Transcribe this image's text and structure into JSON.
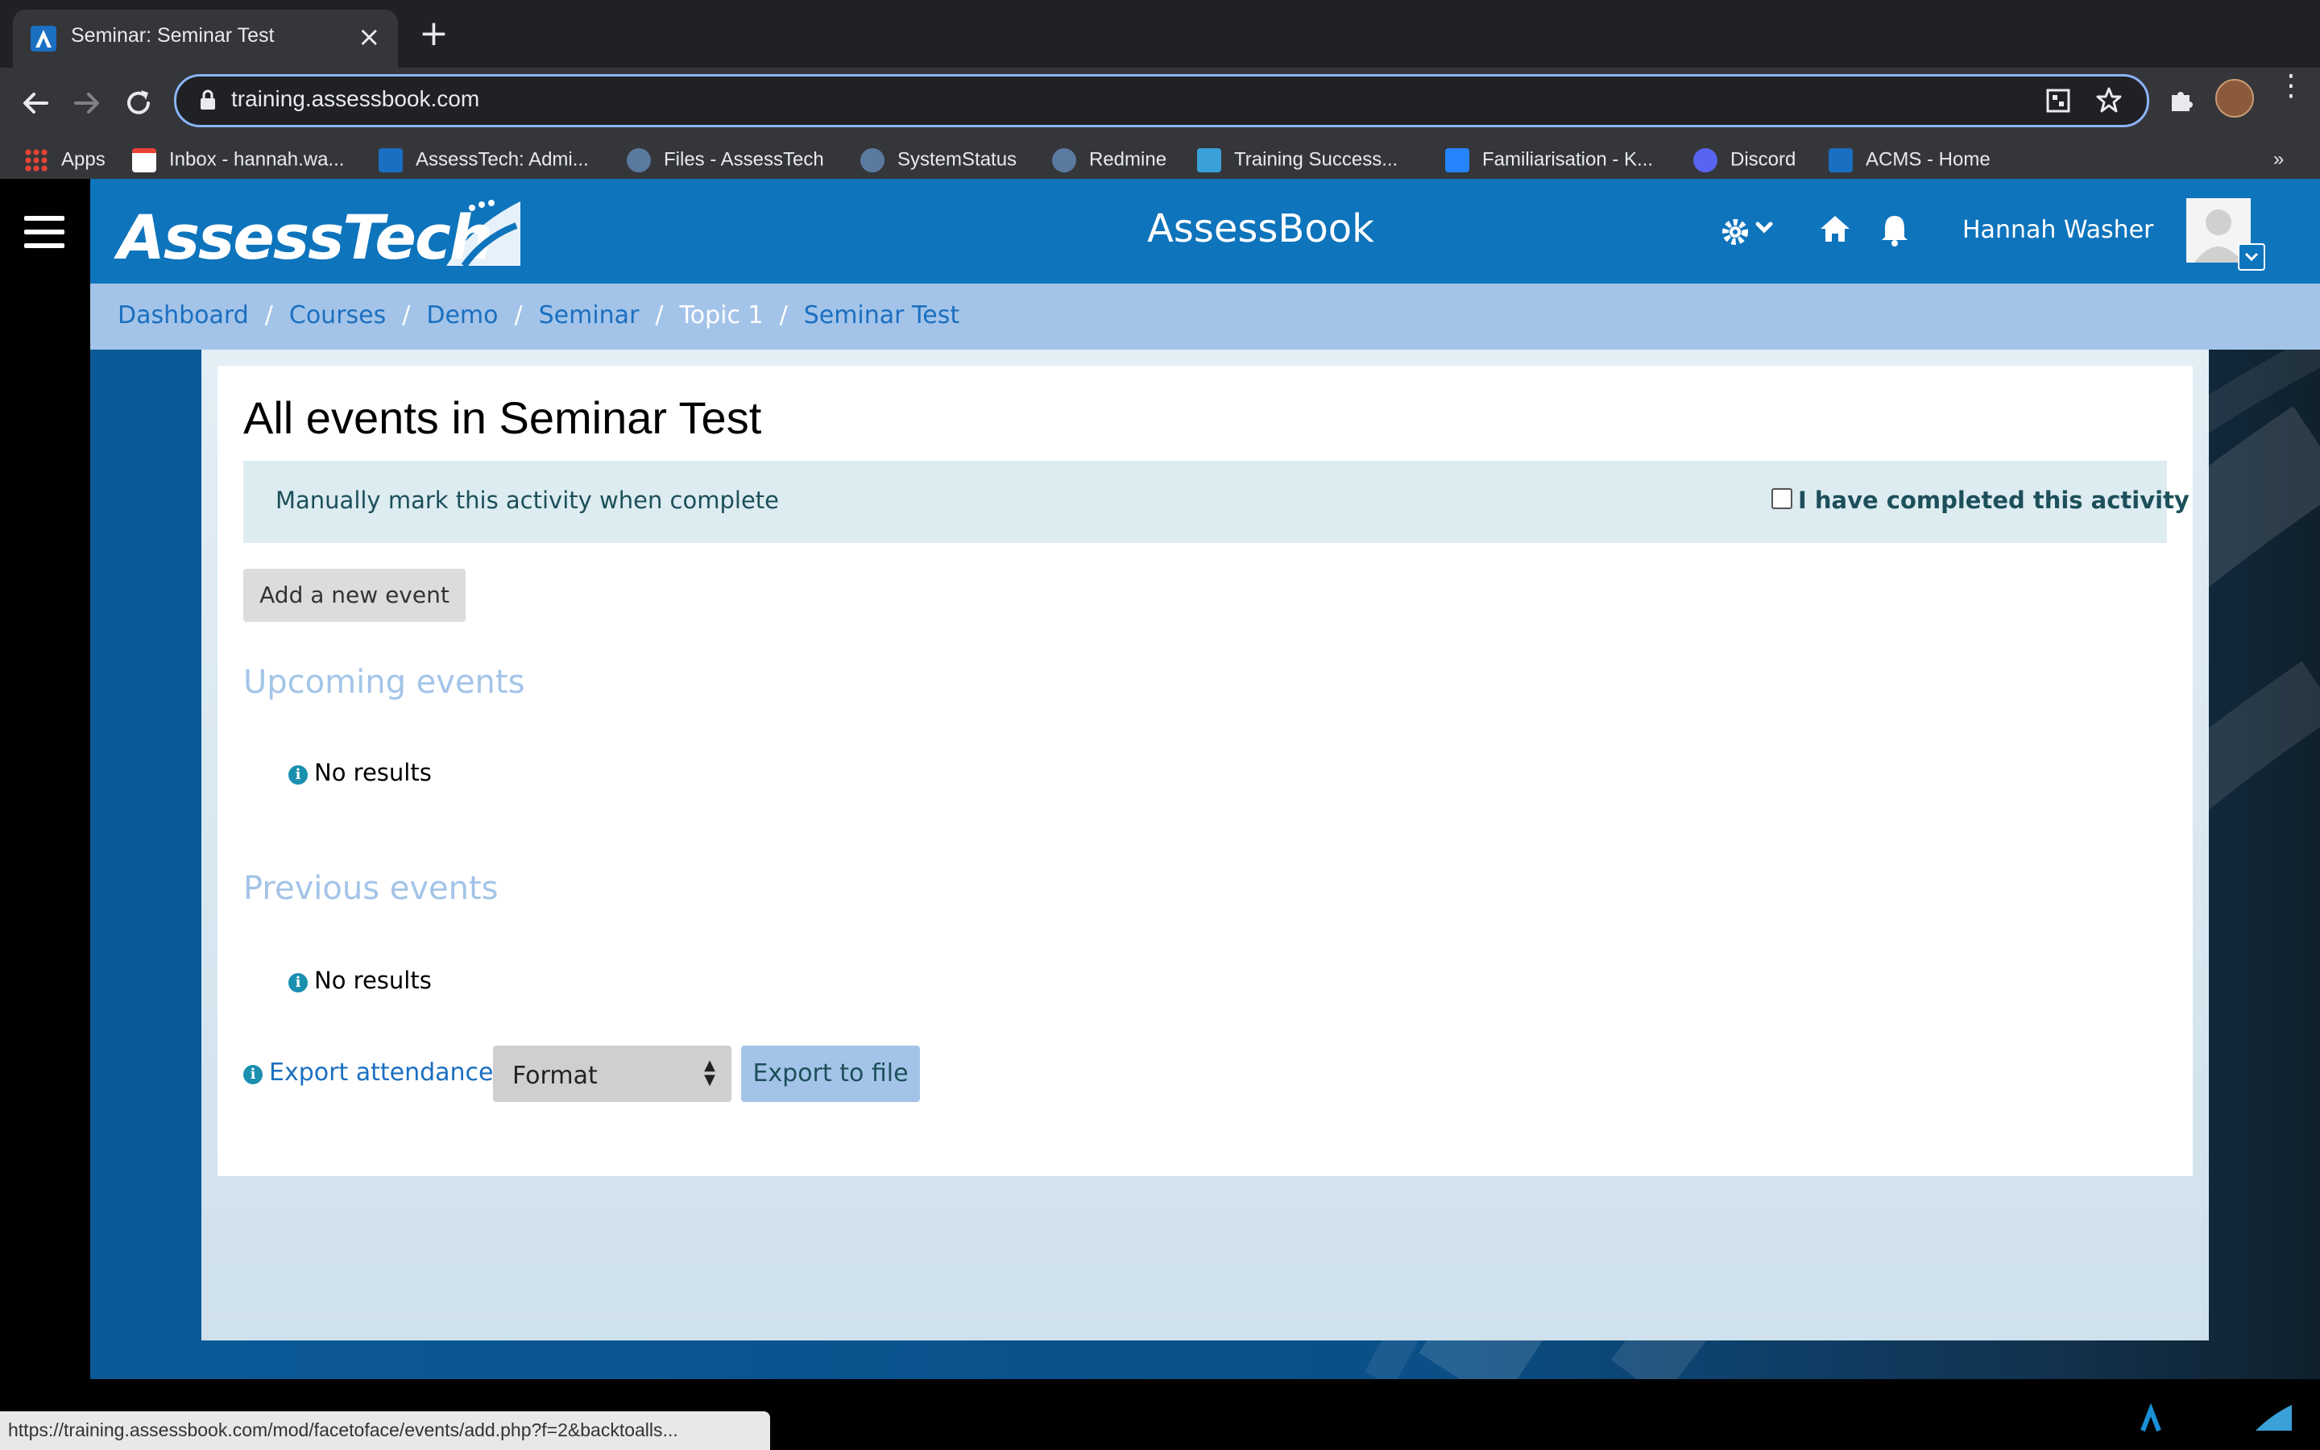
{
  "browser": {
    "tab_title": "Seminar: Seminar Test",
    "url": "training.assessbook.com",
    "status_url": "https://training.assessbook.com/mod/facetoface/events/add.php?f=2&backtoalls...",
    "bookmarks": [
      {
        "label": "Apps",
        "icon": "apps-grid-icon"
      },
      {
        "label": "Inbox - hannah.wa...",
        "icon": "gmail-icon"
      },
      {
        "label": "AssessTech: Admi...",
        "icon": "assesstech-icon"
      },
      {
        "label": "Files - AssessTech",
        "icon": "assesstech-swirl-icon"
      },
      {
        "label": "SystemStatus",
        "icon": "assesstech-swirl-icon"
      },
      {
        "label": "Redmine",
        "icon": "redmine-icon"
      },
      {
        "label": "Training Success...",
        "icon": "training-icon"
      },
      {
        "label": "Familiarisation - K...",
        "icon": "confluence-icon"
      },
      {
        "label": "Discord",
        "icon": "discord-icon"
      },
      {
        "label": "ACMS - Home",
        "icon": "assesstech-icon"
      }
    ],
    "overflow": "»"
  },
  "header": {
    "logo_text": "AssessTech",
    "app_title": "AssessBook",
    "username": "Hannah Washer"
  },
  "breadcrumb": [
    {
      "label": "Dashboard",
      "link": true
    },
    {
      "label": "Courses",
      "link": true
    },
    {
      "label": "Demo",
      "link": true
    },
    {
      "label": "Seminar",
      "link": true
    },
    {
      "label": "Topic 1",
      "link": false
    },
    {
      "label": "Seminar Test",
      "link": true
    }
  ],
  "main": {
    "title": "All events in Seminar Test",
    "completion_label": "Manually mark this activity when complete",
    "completion_checkbox_label": "I have completed this activity",
    "completion_checked": false,
    "add_event_button": "Add a new event",
    "upcoming_heading": "Upcoming events",
    "upcoming_empty": "No results",
    "previous_heading": "Previous events",
    "previous_empty": "No results",
    "export_attendance_link": "Export attendance",
    "format_select": "Format",
    "export_button": "Export to file"
  },
  "colors": {
    "header_blue": "#0e74bc",
    "breadcrumb_bg": "#a3c4e8",
    "link_blue": "#1a6fc1",
    "heading_light_blue": "#a3c4e8",
    "completion_bg": "#dcecf1"
  }
}
